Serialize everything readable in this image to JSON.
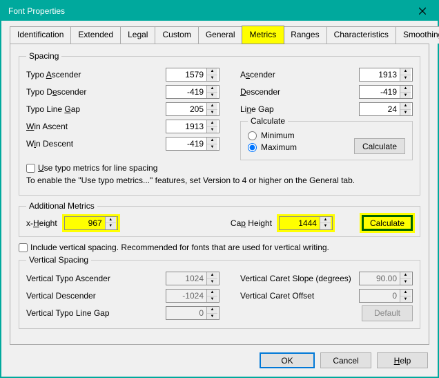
{
  "window": {
    "title": "Font Properties"
  },
  "tabs": [
    "Identification",
    "Extended",
    "Legal",
    "Custom",
    "General",
    "Metrics",
    "Ranges",
    "Characteristics",
    "Smoothing"
  ],
  "active_tab": 5,
  "spacing": {
    "legend": "Spacing",
    "typo_ascender_label": "Typo Ascender",
    "typo_ascender": "1579",
    "typo_descender_label": "Typo Descender",
    "typo_descender": "-419",
    "typo_line_gap_label": "Typo Line Gap",
    "typo_line_gap": "205",
    "win_ascent_label": "Win Ascent",
    "win_ascent": "1913",
    "win_descent_label": "Win Descent",
    "win_descent": "-419",
    "ascender_label": "Ascender",
    "ascender": "1913",
    "descender_label": "Descender",
    "descender": "-419",
    "line_gap_label": "Line Gap",
    "line_gap": "24",
    "calculate_legend": "Calculate",
    "minimum_label": "Minimum",
    "maximum_label": "Maximum",
    "calc_selected": "max",
    "calculate_btn": "Calculate",
    "use_typo_label": "Use typo metrics for line spacing",
    "note": "To enable the \"Use typo metrics...\" features, set Version to 4 or higher on the General tab."
  },
  "additional": {
    "legend": "Additional Metrics",
    "x_height_label": "x-Height",
    "x_height": "967",
    "cap_height_label": "Cap Height",
    "cap_height": "1444",
    "calculate_btn": "Calculate"
  },
  "include_vertical_label": "Include vertical spacing. Recommended for fonts that are used for vertical writing.",
  "vertical": {
    "legend": "Vertical Spacing",
    "typo_asc_label": "Vertical Typo Ascender",
    "typo_asc": "1024",
    "desc_label": "Vertical Descender",
    "desc": "-1024",
    "line_gap_label": "Vertical Typo Line Gap",
    "line_gap": "0",
    "caret_slope_label": "Vertical Caret Slope (degrees)",
    "caret_slope": "90.00",
    "caret_offset_label": "Vertical Caret Offset",
    "caret_offset": "0",
    "default_btn": "Default"
  },
  "buttons": {
    "ok": "OK",
    "cancel": "Cancel",
    "help": "Help"
  }
}
